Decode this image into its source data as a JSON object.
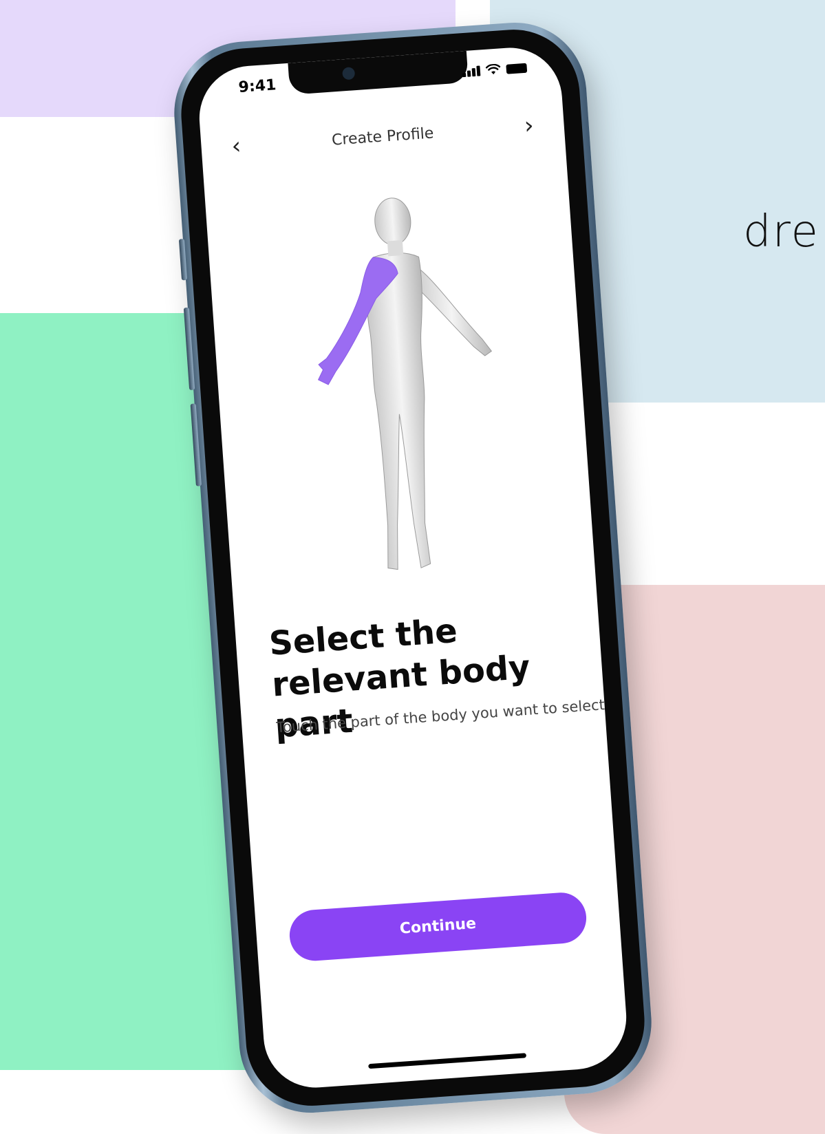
{
  "background": {
    "colors": {
      "lavender": "#e5d9fb",
      "light_blue": "#d6e8f0",
      "mint_green": "#8ff1c3",
      "pink": "#f1d5d5"
    },
    "side_text": "dre"
  },
  "device": {
    "model_color": "sierra-blue",
    "status_bar": {
      "time": "9:41",
      "icons": [
        "signal-icon",
        "wifi-icon",
        "battery-icon"
      ]
    }
  },
  "app": {
    "nav": {
      "title": "Create Profile",
      "back_icon": "chevron-left-icon",
      "back_glyph": "‹",
      "next_icon": "chevron-right-icon",
      "next_glyph": "›"
    },
    "body_model": {
      "selected_part": "right arm",
      "highlight_color": "#9b6cf2"
    },
    "headline": "Select the relevant body part",
    "subtitle": "Touch the part of the body you want to select",
    "primary_button": {
      "label": "Continue",
      "color": "#8a44f4"
    }
  }
}
